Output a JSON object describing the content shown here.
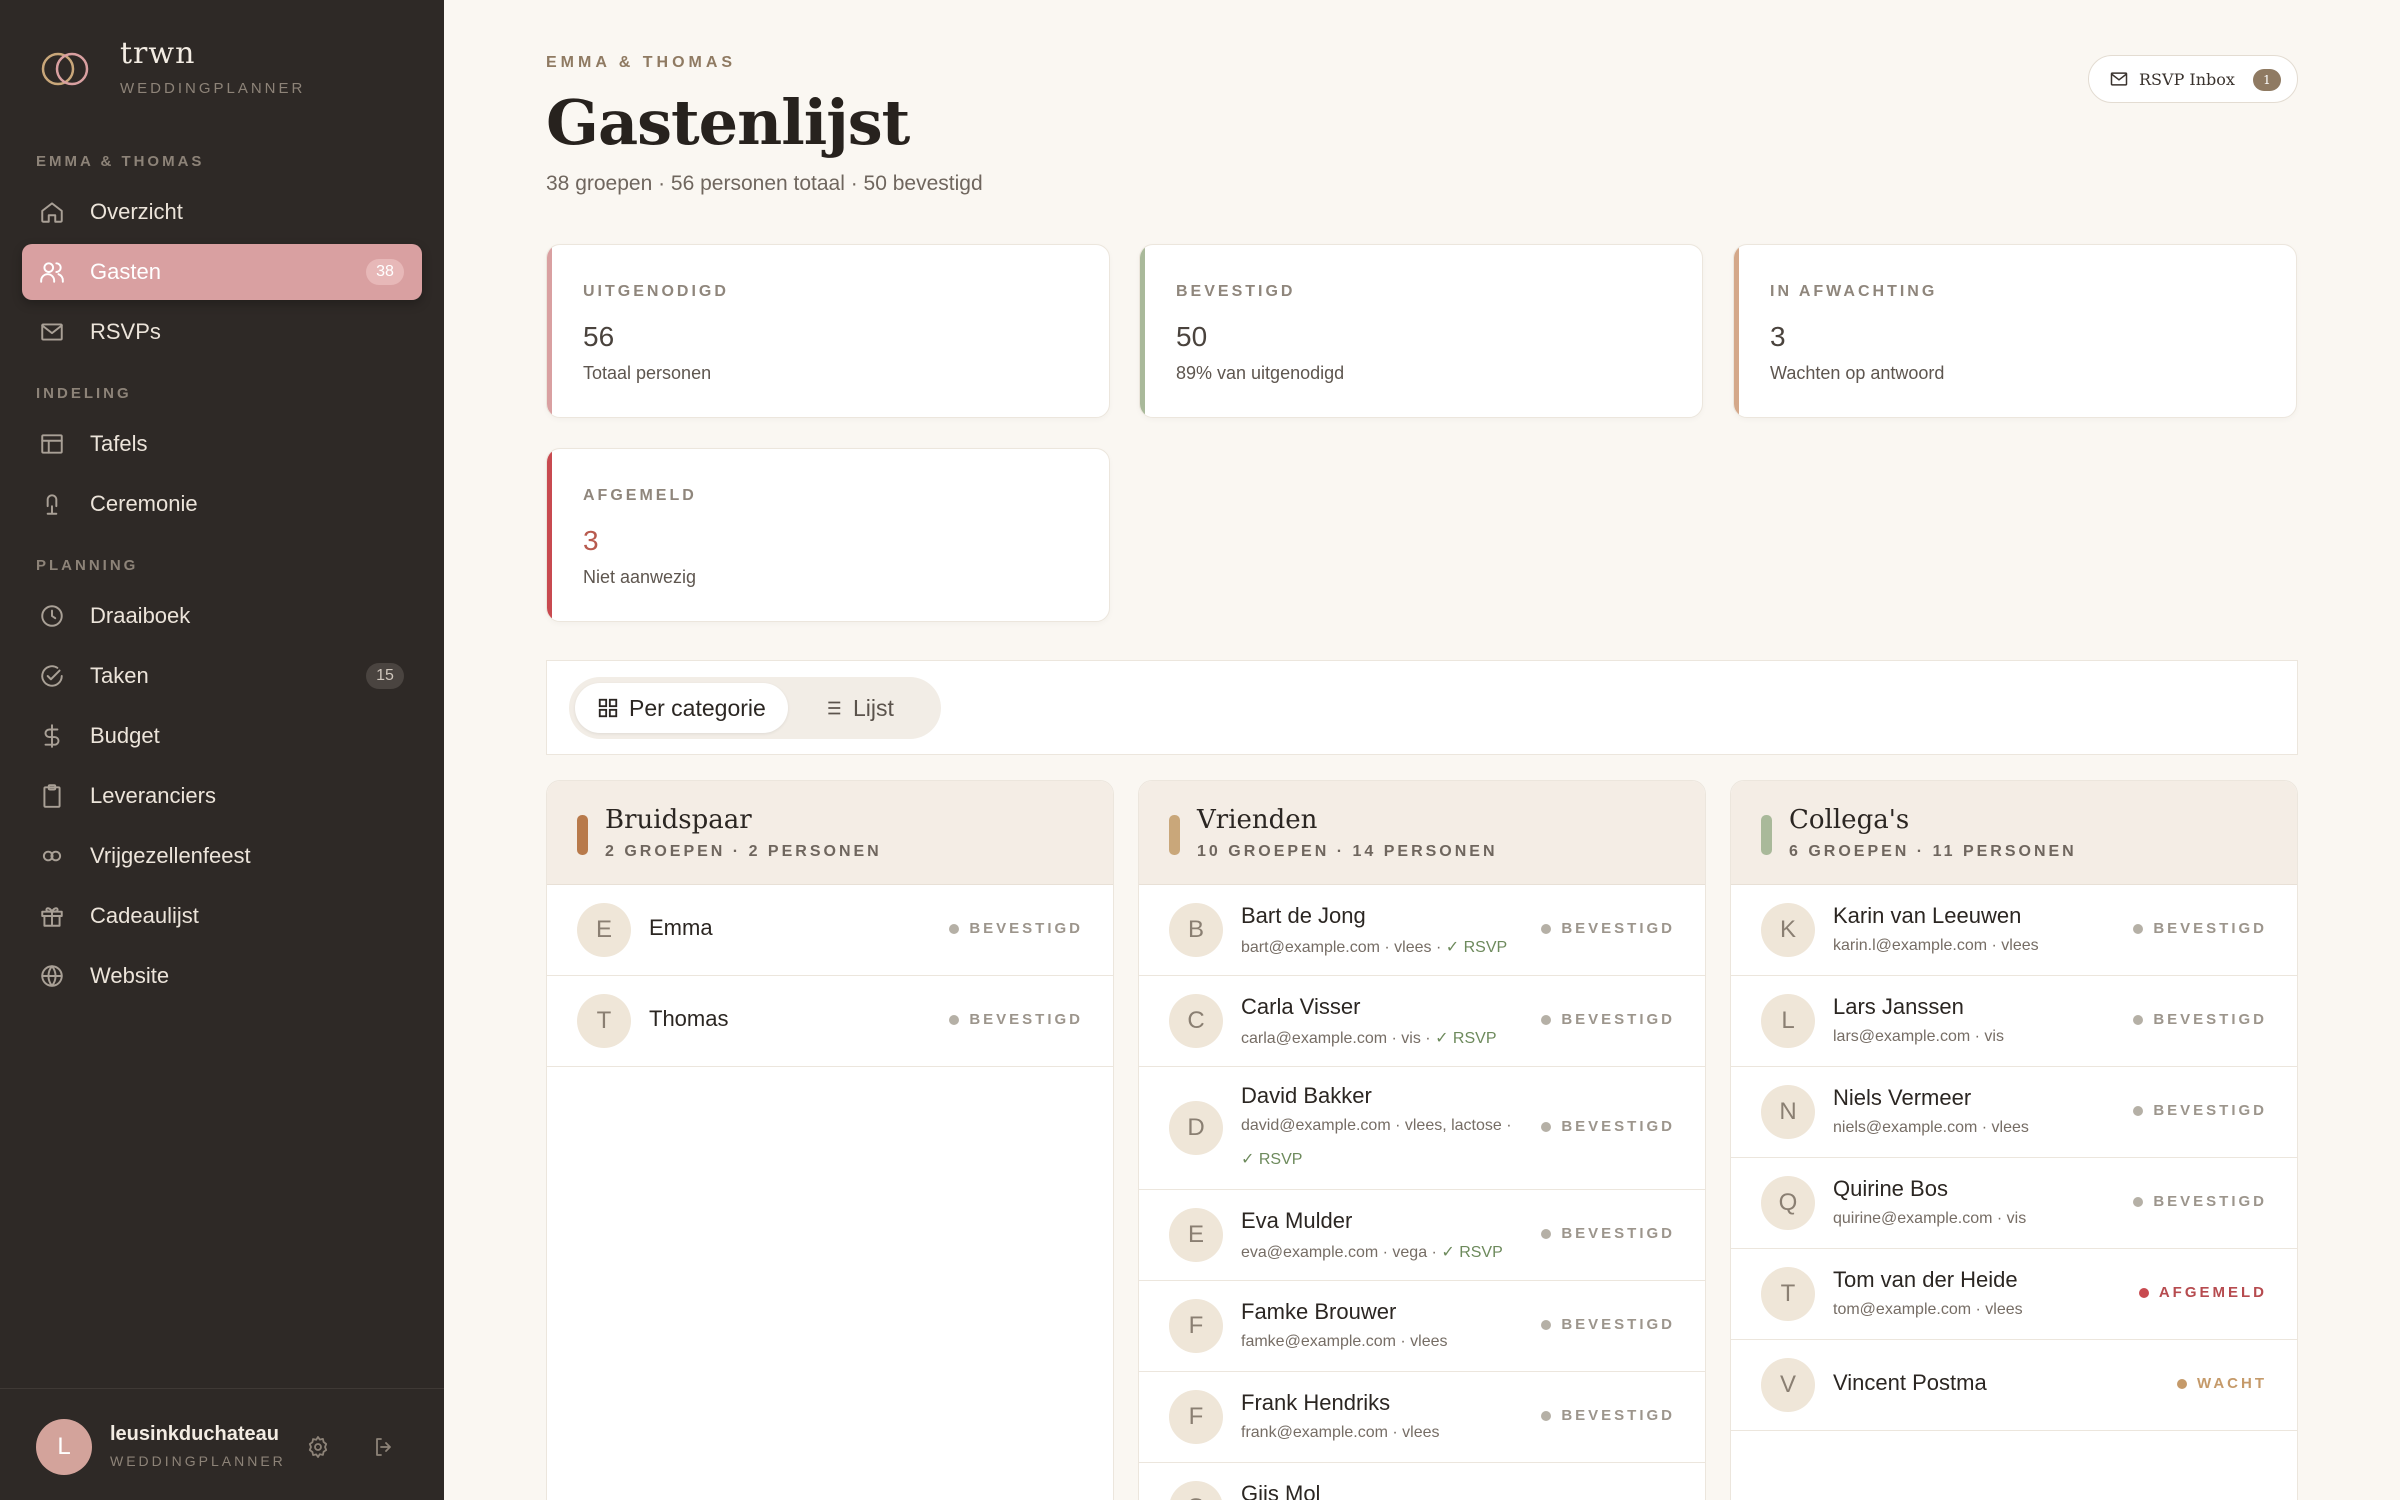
{
  "brand": {
    "name": "trwn",
    "sub": "WEDDINGPLANNER"
  },
  "sidebar": {
    "sections": [
      "EMMA & THOMAS",
      "INDELING",
      "PLANNING"
    ],
    "items": [
      {
        "label": "Overzicht",
        "icon": "home-icon"
      },
      {
        "label": "Gasten",
        "icon": "users-icon",
        "badge": "38",
        "active": true
      },
      {
        "label": "RSVPs",
        "icon": "mail-icon"
      },
      {
        "label": "Tafels",
        "icon": "table-icon"
      },
      {
        "label": "Ceremonie",
        "icon": "arch-icon"
      },
      {
        "label": "Draaiboek",
        "icon": "clock-icon"
      },
      {
        "label": "Taken",
        "icon": "check-circle-icon",
        "badge": "15"
      },
      {
        "label": "Budget",
        "icon": "dollar-icon"
      },
      {
        "label": "Leveranciers",
        "icon": "clipboard-icon"
      },
      {
        "label": "Vrijgezellenfeest",
        "icon": "infinity-icon"
      },
      {
        "label": "Cadeaulijst",
        "icon": "gift-icon"
      },
      {
        "label": "Website",
        "icon": "globe-icon"
      }
    ]
  },
  "user": {
    "initial": "L",
    "name": "leusinkduchateau",
    "role": "WEDDINGPLANNER"
  },
  "header": {
    "eyebrow": "EMMA & THOMAS",
    "title": "Gastenlijst",
    "subtitle": "38 groepen · 56 personen totaal · 50 bevestigd",
    "rsvp_label": "RSVP Inbox",
    "rsvp_count": "1"
  },
  "stats": [
    {
      "label": "UITGENODIGD",
      "value": "56",
      "desc": "Totaal personen",
      "color": "#d9a0a1"
    },
    {
      "label": "BEVESTIGD",
      "value": "50",
      "desc": "89% van uitgenodigd",
      "color": "#a9b99a"
    },
    {
      "label": "IN AFWACHTING",
      "value": "3",
      "desc": "Wachten op antwoord",
      "color": "#d4a88a"
    },
    {
      "label": "AFGEMELD",
      "value": "3",
      "desc": "Niet aanwezig",
      "color": "#c84a50"
    }
  ],
  "view": {
    "category_label": "Per categorie",
    "list_label": "Lijst"
  },
  "columns": [
    {
      "title": "Bruidspaar",
      "meta": "2 GROEPEN · 2 PERSONEN",
      "accent": "#b87a4b",
      "guests": [
        {
          "initial": "E",
          "name": "Emma",
          "status": "BEVESTIGD"
        },
        {
          "initial": "T",
          "name": "Thomas",
          "status": "BEVESTIGD"
        }
      ]
    },
    {
      "title": "Vrienden",
      "meta": "10 GROEPEN · 14 PERSONEN",
      "accent": "#c9a77a",
      "guests": [
        {
          "initial": "B",
          "name": "Bart de Jong",
          "meta": "bart@example.com · vlees",
          "rsvp": "RSVP",
          "status": "BEVESTIGD"
        },
        {
          "initial": "C",
          "name": "Carla Visser",
          "meta": "carla@example.com · vis",
          "rsvp": "RSVP",
          "status": "BEVESTIGD"
        },
        {
          "initial": "D",
          "name": "David Bakker",
          "meta": "david@example.com · vlees, lactose",
          "rsvp": "RSVP",
          "status": "BEVESTIGD",
          "wrap": true
        },
        {
          "initial": "E",
          "name": "Eva Mulder",
          "meta": "eva@example.com · vega",
          "rsvp": "RSVP",
          "status": "BEVESTIGD"
        },
        {
          "initial": "F",
          "name": "Famke Brouwer",
          "meta": "famke@example.com · vlees",
          "status": "BEVESTIGD"
        },
        {
          "initial": "F",
          "name": "Frank Hendriks",
          "meta": "frank@example.com · vlees",
          "status": "BEVESTIGD"
        },
        {
          "initial": "G",
          "name": "Gijs Mol",
          "meta": "",
          "status": ""
        }
      ]
    },
    {
      "title": "Collega's",
      "meta": "6 GROEPEN · 11 PERSONEN",
      "accent": "#a9b99a",
      "guests": [
        {
          "initial": "K",
          "name": "Karin van Leeuwen",
          "meta": "karin.l@example.com · vlees",
          "status": "BEVESTIGD"
        },
        {
          "initial": "L",
          "name": "Lars Janssen",
          "meta": "lars@example.com · vis",
          "status": "BEVESTIGD"
        },
        {
          "initial": "N",
          "name": "Niels Vermeer",
          "meta": "niels@example.com · vlees",
          "status": "BEVESTIGD"
        },
        {
          "initial": "Q",
          "name": "Quirine Bos",
          "meta": "quirine@example.com · vis",
          "status": "BEVESTIGD"
        },
        {
          "initial": "T",
          "name": "Tom van der Heide",
          "meta": "tom@example.com · vlees",
          "status": "AFGEMELD",
          "kind": "afg"
        },
        {
          "initial": "V",
          "name": "Vincent Postma",
          "status": "WACHT",
          "kind": "wacht"
        }
      ]
    }
  ]
}
